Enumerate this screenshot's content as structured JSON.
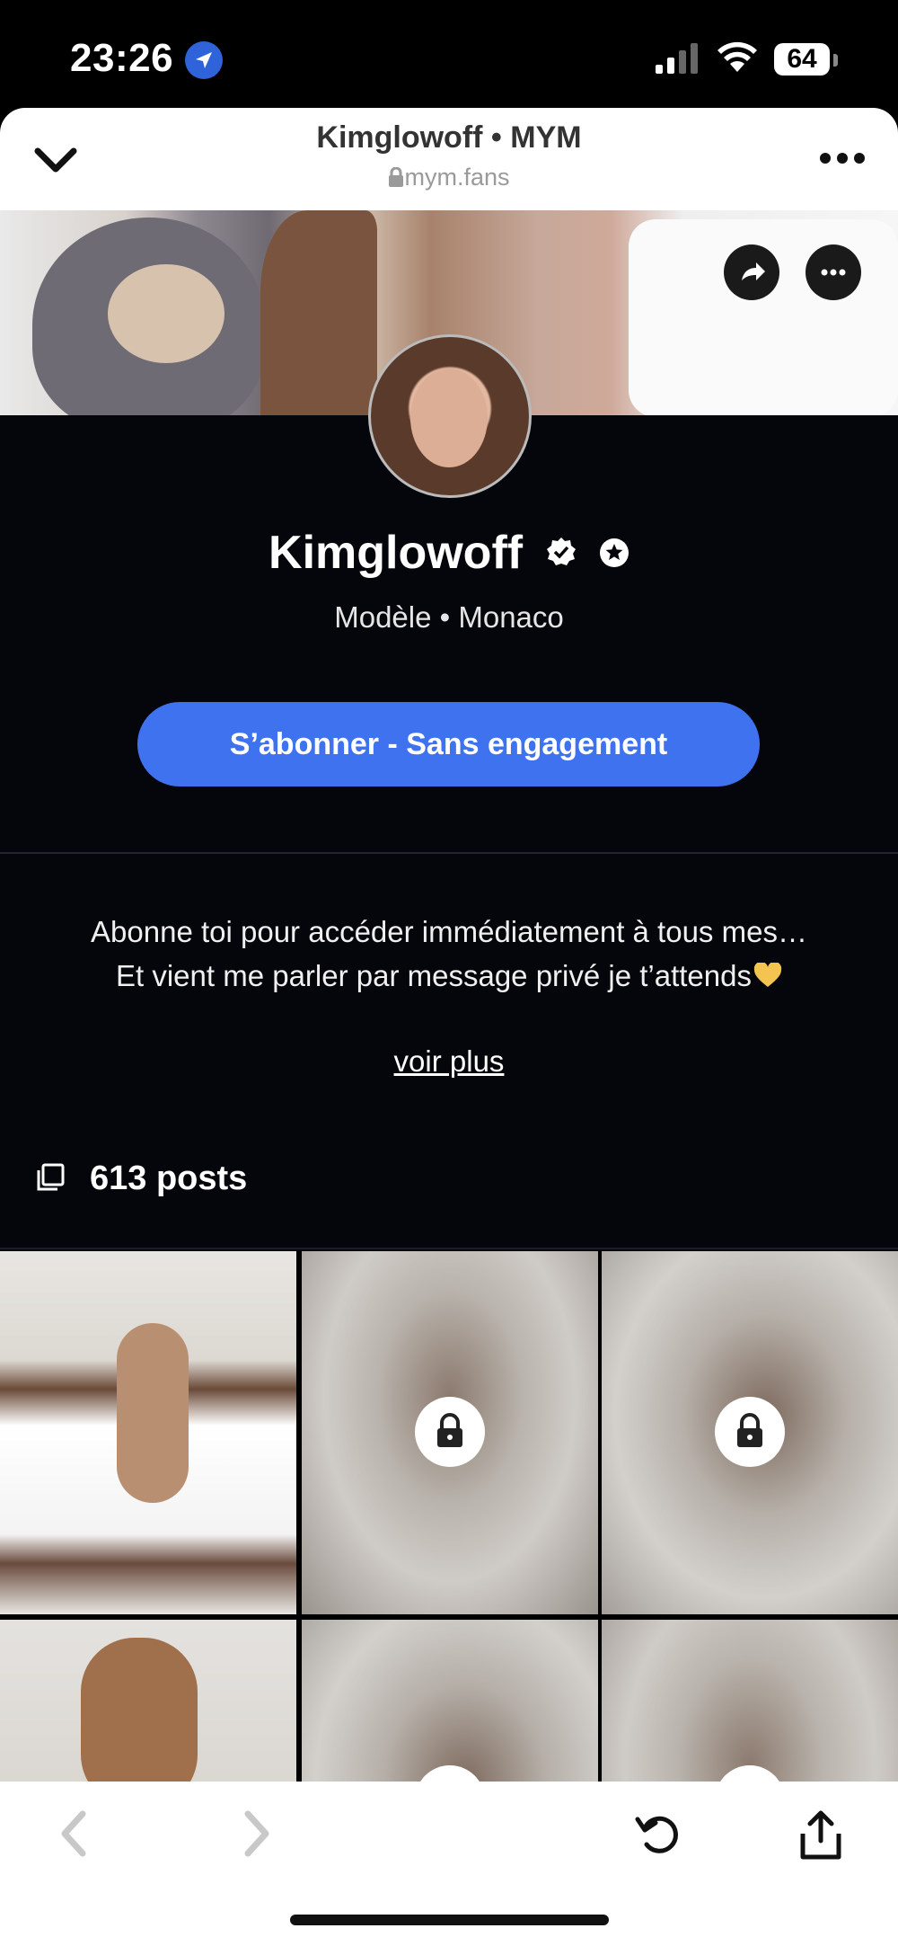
{
  "status_bar": {
    "time": "23:26",
    "battery": "64"
  },
  "browser": {
    "title": "Kimglowoff • MYM",
    "url": "mym.fans"
  },
  "profile": {
    "name": "Kimglowoff",
    "subtitle": "Modèle • Monaco",
    "subscribe_label": "S’abonner - Sans engagement",
    "bio_line1": "Abonne toi pour accéder immédiatement à tous mes…",
    "bio_line2": "Et vient me parler par message privé je t’attends",
    "see_more": "voir plus",
    "posts_count": "613 posts"
  },
  "colors": {
    "accent": "#3f72ef",
    "background": "#05050c",
    "heart": "#f3c44f"
  },
  "grid": {
    "tiles": [
      {
        "locked": false
      },
      {
        "locked": true
      },
      {
        "locked": true
      },
      {
        "locked": false
      },
      {
        "locked": true
      },
      {
        "locked": true
      }
    ]
  }
}
